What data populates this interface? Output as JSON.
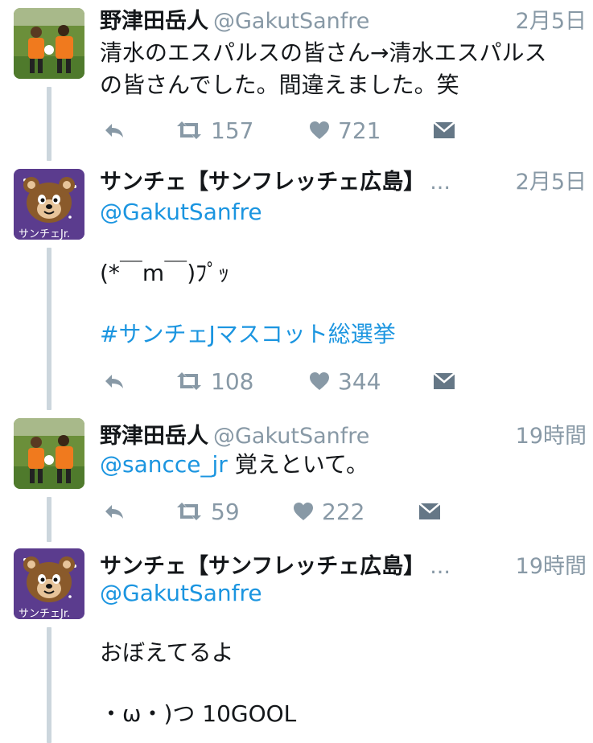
{
  "tweets": [
    {
      "name": "野津田岳人",
      "handle": "@GakutSanfre",
      "time": "2月5日",
      "lines": [
        "清水のエスパルスの皆さん→清水エスパルス",
        "の皆さんでした。間違えました。笑"
      ],
      "retweets": "157",
      "likes": "721",
      "avatar": "player-photo"
    },
    {
      "name": "サンチェ【サンフレッチェ広島】",
      "ellipsis": "...",
      "handle": "@GakutSanfre",
      "time": "2月5日",
      "body_line1": "(*￣m￣)ﾌﾟｯ",
      "hashtag": "#サンチェJマスコット総選挙",
      "retweets": "108",
      "likes": "344",
      "avatar": "bear-mascot",
      "avatar_caption": "サンチェJr."
    },
    {
      "name": "野津田岳人",
      "handle": "@GakutSanfre",
      "time": "19時間",
      "mention": "@sancce_jr",
      "body_rest": " 覚えといて。",
      "retweets": "59",
      "likes": "222",
      "avatar": "player-photo"
    },
    {
      "name": "サンチェ【サンフレッチェ広島】",
      "ellipsis": "...",
      "handle": "@GakutSanfre",
      "time": "19時間",
      "body_line1": "おぼえてるよ",
      "body_line2": "・ω・)つ 10GOOL",
      "avatar": "bear-mascot",
      "avatar_caption": "サンチェJr."
    }
  ],
  "colors": {
    "link": "#1b95e0",
    "muted": "#8899a6",
    "thread_line": "#ccd6dd"
  },
  "icons": [
    "reply-icon",
    "retweet-icon",
    "like-icon",
    "message-icon"
  ]
}
